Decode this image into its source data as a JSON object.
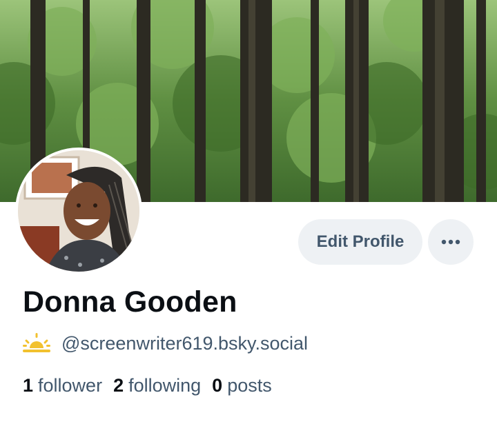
{
  "profile": {
    "display_name": "Donna Gooden",
    "handle": "@screenwriter619.bsky.social",
    "handle_icon": "sunrise-icon",
    "banner_image": "forest-trees-banner",
    "avatar_image": "profile-photo"
  },
  "actions": {
    "edit_profile_label": "Edit Profile",
    "more_icon": "more-horizontal-icon"
  },
  "stats": {
    "followers_count": "1",
    "followers_label": "follower",
    "following_count": "2",
    "following_label": "following",
    "posts_count": "0",
    "posts_label": "posts"
  },
  "colors": {
    "secondary_text": "#42576c",
    "button_bg": "#eef1f4",
    "primary_text": "#0b0f14",
    "handle_icon": "#f2c12e"
  }
}
